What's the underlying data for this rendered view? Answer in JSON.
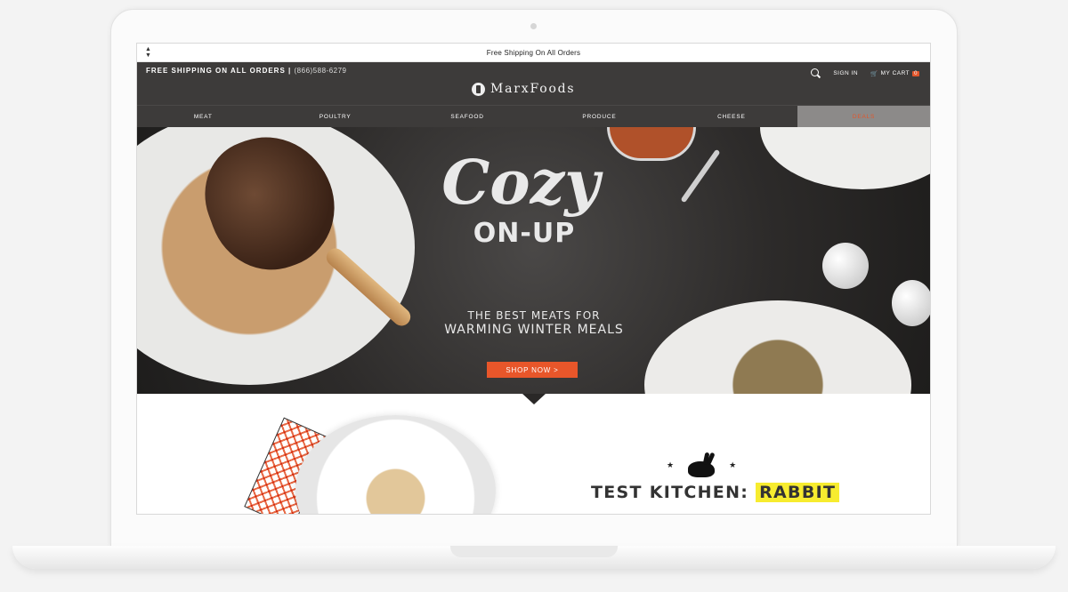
{
  "browser": {
    "url_text": "Free Shipping On All Orders",
    "nav_arrows": "▲\n▼"
  },
  "header": {
    "promo_text": "FREE SHIPPING ON ALL ORDERS |",
    "phone": "(866)588-6279",
    "logo_text": "MarxFoods",
    "sign_in": "SIGN IN",
    "cart_label": "MY CART",
    "cart_count": "0"
  },
  "nav": {
    "items": [
      "MEAT",
      "POULTRY",
      "SEAFOOD",
      "PRODUCE",
      "CHEESE",
      "DEALS"
    ]
  },
  "hero": {
    "title": "Cozy",
    "subtitle": "ON-UP",
    "tagline_1": "THE BEST MEATS FOR",
    "tagline_2": "WARMING WINTER MEALS",
    "cta": "SHOP NOW >"
  },
  "feature": {
    "heading": "TEST KITCHEN:",
    "highlight": "RABBIT",
    "star": "★"
  },
  "colors": {
    "header_bg": "#3d3b3a",
    "accent": "#e8562a",
    "deals_bg": "#8c8a89",
    "highlight": "#f7ec2f"
  },
  "icons": [
    "search-icon",
    "cart-icon",
    "logo-icon",
    "rabbit-icon",
    "star-icon",
    "scroll-arrows-icon"
  ]
}
